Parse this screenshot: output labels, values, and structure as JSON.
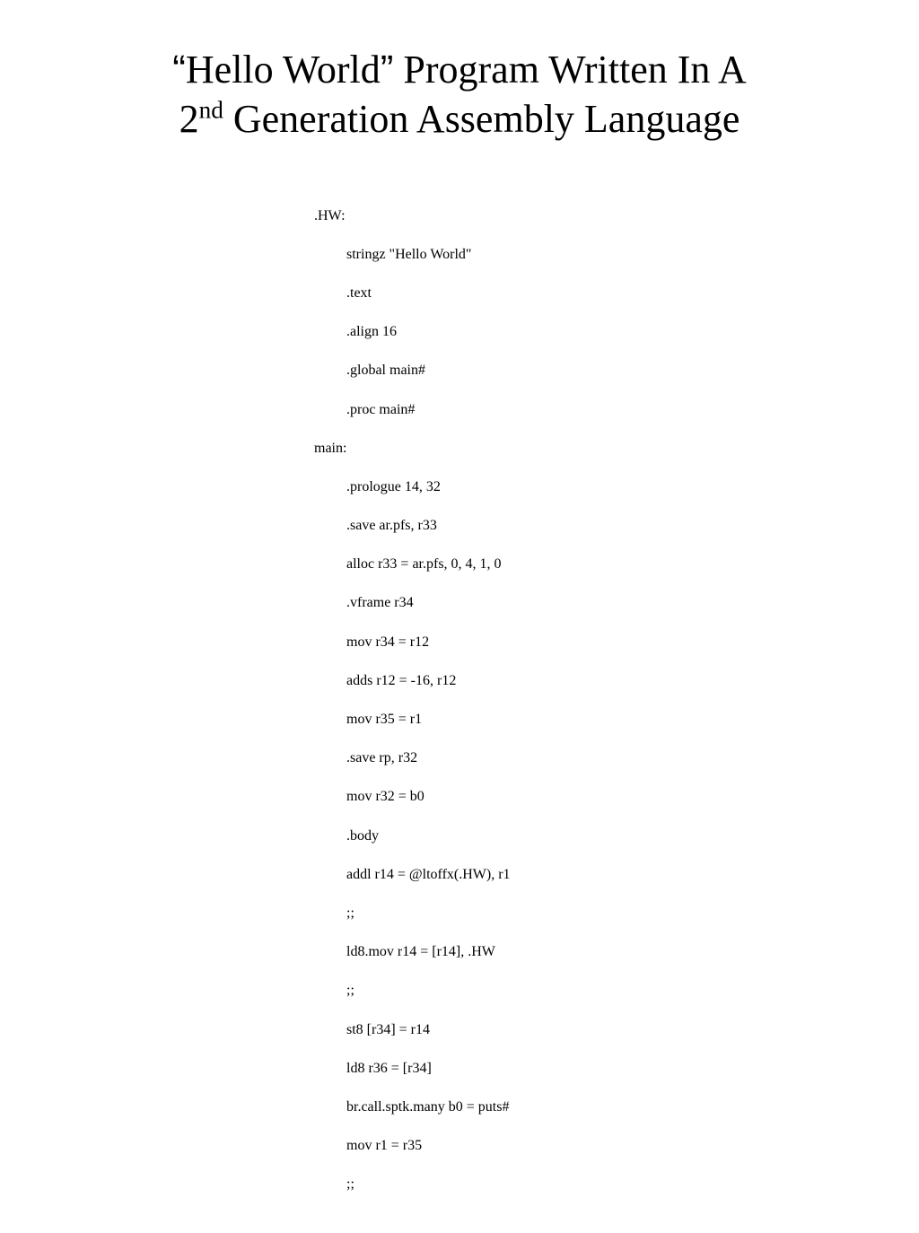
{
  "title": {
    "quote_open": "“",
    "hello_world": "Hello World",
    "quote_close": "”",
    "rest1": " Program Written In A",
    "num": "2",
    "sup": "nd",
    "rest2": " Generation Assembly Language"
  },
  "code": {
    "l01": ".HW:",
    "l02": "stringz \"Hello World\"",
    "l03": ".text",
    "l04": ".align 16",
    "l05": ".global main#",
    "l06": ".proc main#",
    "l07": "main:",
    "l08": ".prologue 14, 32",
    "l09": ".save ar.pfs, r33",
    "l10": "alloc r33 = ar.pfs, 0, 4, 1, 0",
    "l11": ".vframe r34",
    "l12": "mov r34 = r12",
    "l13": "adds r12 = -16, r12",
    "l14": "mov r35 = r1",
    "l15": ".save rp, r32",
    "l16": "mov r32 = b0",
    "l17": ".body",
    "l18": "addl r14 = @ltoffx(.HW), r1",
    "l19": ";;",
    "l20": "ld8.mov r14 = [r14], .HW",
    "l21": ";;",
    "l22": "st8 [r34] = r14",
    "l23": "ld8 r36 = [r34]",
    "l24": "br.call.sptk.many b0 = puts#",
    "l25": "mov r1 = r35",
    "l26": ";;"
  }
}
